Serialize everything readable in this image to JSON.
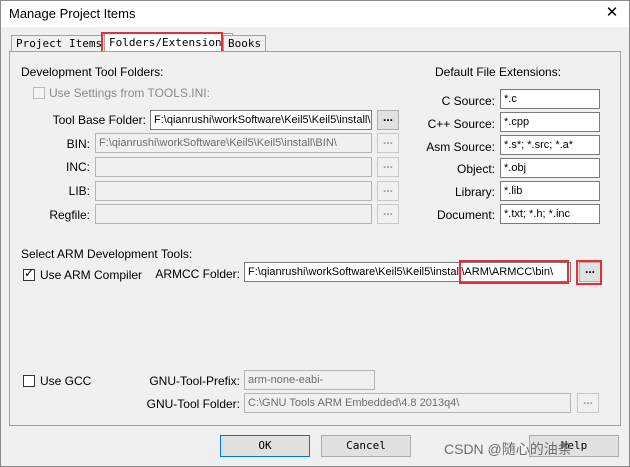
{
  "window": {
    "title": "Manage Project Items",
    "close_glyph": "✕"
  },
  "tabs": [
    {
      "label": "Project Items"
    },
    {
      "label": "Folders/Extensions"
    },
    {
      "label": "Books"
    }
  ],
  "dev_tool_folders": {
    "heading": "Development Tool Folders:",
    "use_settings_label": "Use Settings from TOOLS.INI:",
    "tool_base_label": "Tool Base Folder:",
    "tool_base_value": "F:\\qianrushi\\workSoftware\\Keil5\\Keil5\\install\\",
    "bin_label": "BIN:",
    "bin_value": "F:\\qianrushi\\workSoftware\\Keil5\\Keil5\\install\\BIN\\",
    "inc_label": "INC:",
    "lib_label": "LIB:",
    "regfile_label": "Regfile:",
    "browse_label": "..."
  },
  "extensions": {
    "heading": "Default File Extensions:",
    "rows": [
      {
        "label": "C Source:",
        "value": "*.c"
      },
      {
        "label": "C++ Source:",
        "value": "*.cpp"
      },
      {
        "label": "Asm Source:",
        "value": "*.s*; *.src; *.a*"
      },
      {
        "label": "Object:",
        "value": "*.obj"
      },
      {
        "label": "Library:",
        "value": "*.lib"
      },
      {
        "label": "Document:",
        "value": "*.txt; *.h; *.inc"
      }
    ]
  },
  "arm_tools": {
    "heading": "Select ARM Development Tools:",
    "use_arm_label": "Use ARM Compiler",
    "armcc_label": "ARMCC Folder:",
    "armcc_value": "F:\\qianrushi\\workSoftware\\Keil5\\Keil5\\install\\ARM\\ARMCC\\bin\\",
    "browse_label": "..."
  },
  "gcc": {
    "use_gcc_label": "Use GCC",
    "prefix_label": "GNU-Tool-Prefix:",
    "prefix_value": "arm-none-eabi-",
    "folder_label": "GNU-Tool Folder:",
    "folder_value": "C:\\GNU Tools ARM Embedded\\4.8 2013q4\\",
    "browse_label": "..."
  },
  "buttons": {
    "ok": "OK",
    "cancel": "Cancel",
    "help": "Help"
  },
  "watermark": "CSDN @随心的油条",
  "colors": {
    "highlight": "#e0303a"
  }
}
